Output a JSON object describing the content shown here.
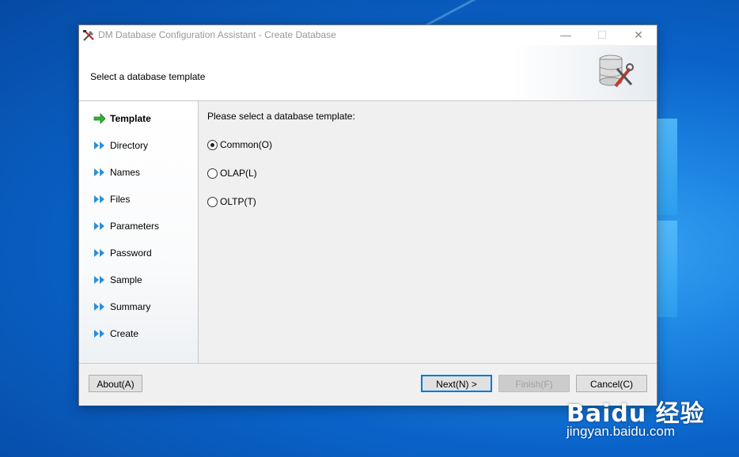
{
  "window": {
    "title": "DM Database Configuration Assistant - Create Database",
    "controls": {
      "minimize": "—",
      "maximize": "☐",
      "close": "✕"
    },
    "app_icon": "tools-icon"
  },
  "banner": {
    "heading": "Select a database template",
    "icon": "database-tools-icon"
  },
  "steps": [
    {
      "label": "Template",
      "icon": "green-arrow-icon",
      "active": true
    },
    {
      "label": "Directory",
      "icon": "double-chevron-icon",
      "active": false
    },
    {
      "label": "Names",
      "icon": "double-chevron-icon",
      "active": false
    },
    {
      "label": "Files",
      "icon": "double-chevron-icon",
      "active": false
    },
    {
      "label": "Parameters",
      "icon": "double-chevron-icon",
      "active": false
    },
    {
      "label": "Password",
      "icon": "double-chevron-icon",
      "active": false
    },
    {
      "label": "Sample",
      "icon": "double-chevron-icon",
      "active": false
    },
    {
      "label": "Summary",
      "icon": "double-chevron-icon",
      "active": false
    },
    {
      "label": "Create",
      "icon": "double-chevron-icon",
      "active": false
    }
  ],
  "content": {
    "prompt": "Please select a database template:",
    "options": [
      {
        "label": "Common(O)",
        "selected": true
      },
      {
        "label": "OLAP(L)",
        "selected": false
      },
      {
        "label": "OLTP(T)",
        "selected": false
      }
    ]
  },
  "buttons": {
    "about": "About(A)",
    "next": "Next(N) >",
    "finish": "Finish(F)",
    "cancel": "Cancel(C)"
  },
  "watermark": {
    "logo": "Baidu 经验",
    "url": "jingyan.baidu.com"
  },
  "colors": {
    "accent": "#0078d7",
    "active_arrow": "#2fb52f",
    "step_arrow": "#2a8fd8",
    "desktop": "#0a63c9"
  }
}
